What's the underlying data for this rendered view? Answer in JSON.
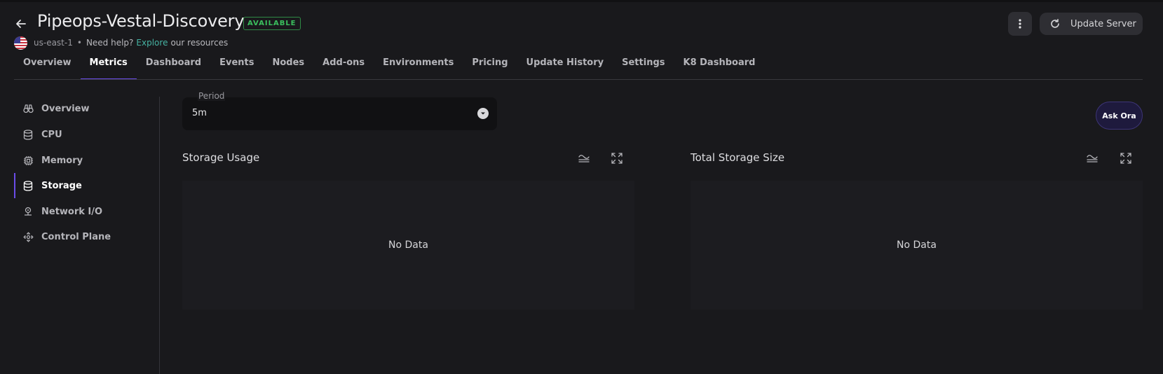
{
  "header": {
    "title": "Pipeops-Vestal-Discovery",
    "status_badge": "AVAILABLE",
    "region": "us-east-1",
    "separator": "•",
    "help_text": "Need help?",
    "explore_link": "Explore",
    "resources_text": "our resources",
    "update_button": "Update Server"
  },
  "tabs": [
    {
      "label": "Overview",
      "active": false
    },
    {
      "label": "Metrics",
      "active": true
    },
    {
      "label": "Dashboard",
      "active": false
    },
    {
      "label": "Events",
      "active": false
    },
    {
      "label": "Nodes",
      "active": false
    },
    {
      "label": "Add-ons",
      "active": false
    },
    {
      "label": "Environments",
      "active": false
    },
    {
      "label": "Pricing",
      "active": false
    },
    {
      "label": "Update History",
      "active": false
    },
    {
      "label": "Settings",
      "active": false
    },
    {
      "label": "K8 Dashboard",
      "active": false
    }
  ],
  "sidebar": {
    "items": [
      {
        "label": "Overview",
        "icon": "binoculars-icon",
        "active": false
      },
      {
        "label": "CPU",
        "icon": "database-icon",
        "active": false
      },
      {
        "label": "Memory",
        "icon": "chip-icon",
        "active": false
      },
      {
        "label": "Storage",
        "icon": "database-icon",
        "active": true
      },
      {
        "label": "Network I/O",
        "icon": "network-icon",
        "active": false
      },
      {
        "label": "Control Plane",
        "icon": "control-plane-icon",
        "active": false
      }
    ]
  },
  "filters": {
    "period_label": "Period",
    "period_value": "5m"
  },
  "ask_button": "Ask Ora",
  "panels": [
    {
      "title": "Storage Usage",
      "empty_text": "No Data"
    },
    {
      "title": "Total Storage Size",
      "empty_text": "No Data"
    }
  ],
  "colors": {
    "accent": "#6a4ce8",
    "available": "#3bbf5e",
    "link": "#46b3a3",
    "background": "#19191c"
  }
}
